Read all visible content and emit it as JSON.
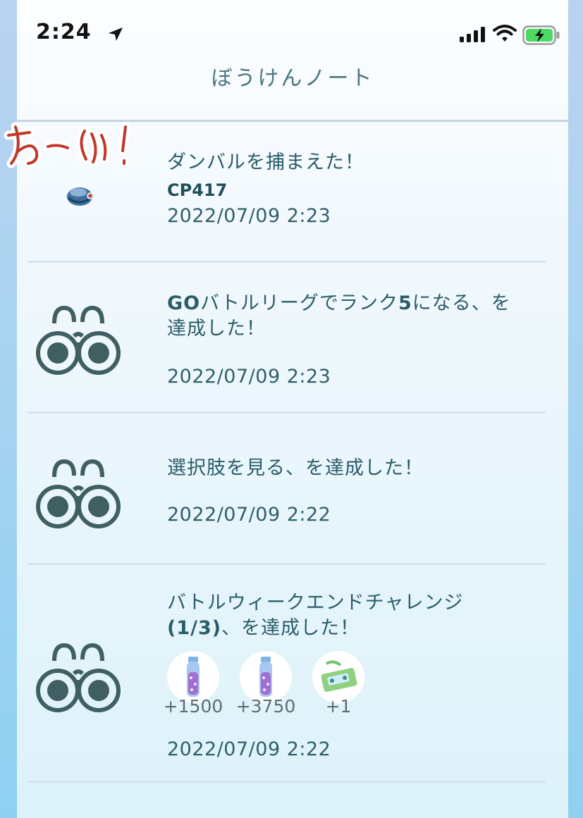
{
  "status_bar": {
    "time": "2:24"
  },
  "header": {
    "title": "ぼうけんノート"
  },
  "sticker": {
    "text": "わーい!"
  },
  "entries": [
    {
      "type": "catch",
      "message": "ダンバルを捕まえた！",
      "cp": "CP417",
      "date": "2022/07/09 2:23",
      "thumb_icon": "beldum-icon"
    },
    {
      "type": "achievement",
      "message_bold_1": "GO",
      "message_part_1": "バトルリーグでランク",
      "message_bold_2": "5",
      "message_part_2": "になる、を",
      "message_line_2": "達成した！",
      "date": "2022/07/09 2:23",
      "thumb_icon": "binoculars-icon"
    },
    {
      "type": "achievement",
      "message": "選択肢を見る、を達成した！",
      "date": "2022/07/09 2:22",
      "thumb_icon": "binoculars-icon"
    },
    {
      "type": "achievement",
      "message_line_1": "バトルウィークエンドチャレンジ",
      "message_bold": "(1/3)",
      "message_line_2_rest": "、を達成した！",
      "date": "2022/07/09 2:22",
      "thumb_icon": "binoculars-icon",
      "rewards": [
        {
          "icon": "stardust-vial-icon",
          "value": "+1500"
        },
        {
          "icon": "stardust-vial-icon",
          "value": "+3750"
        },
        {
          "icon": "premium-battle-pass-icon",
          "value": "+1"
        }
      ]
    }
  ],
  "colors": {
    "text": "#2a5d69",
    "header_text": "#4a7680",
    "icon": "#3f5f63",
    "sticker_red": "#c0392b",
    "battery_green": "#4cd964"
  }
}
